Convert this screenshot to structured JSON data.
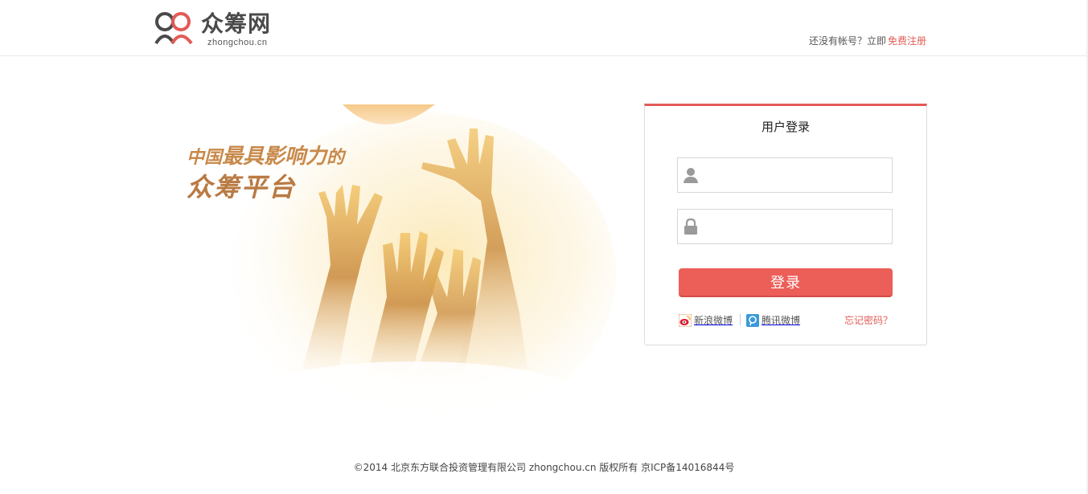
{
  "header": {
    "logo_text": "众筹网",
    "logo_sub": "zhongchou.cn",
    "register_prefix": "还没有帐号？立即",
    "register_link": "免费注册"
  },
  "hero": {
    "slogan_line1_a": "中国",
    "slogan_line1_b": "最具影响力",
    "slogan_line1_c": "的",
    "slogan_line2": "众筹平台"
  },
  "login": {
    "title": "用户登录",
    "username": {
      "value": "",
      "placeholder": "",
      "icon": "user-icon"
    },
    "password": {
      "value": "",
      "placeholder": "",
      "icon": "lock-icon"
    },
    "submit_label": "登录",
    "weibo_label": "新浪微博",
    "qq_weibo_label": "腾讯微博",
    "forgot_label": "忘记密码？"
  },
  "footer": {
    "copyright": "©2014 北京东方联合投资管理有限公司 zhongchou.cn 版权所有 京ICP备14016844号"
  },
  "colors": {
    "accent": "#e25b55",
    "button": "#ec5e58",
    "slogan": "#c8894a"
  }
}
